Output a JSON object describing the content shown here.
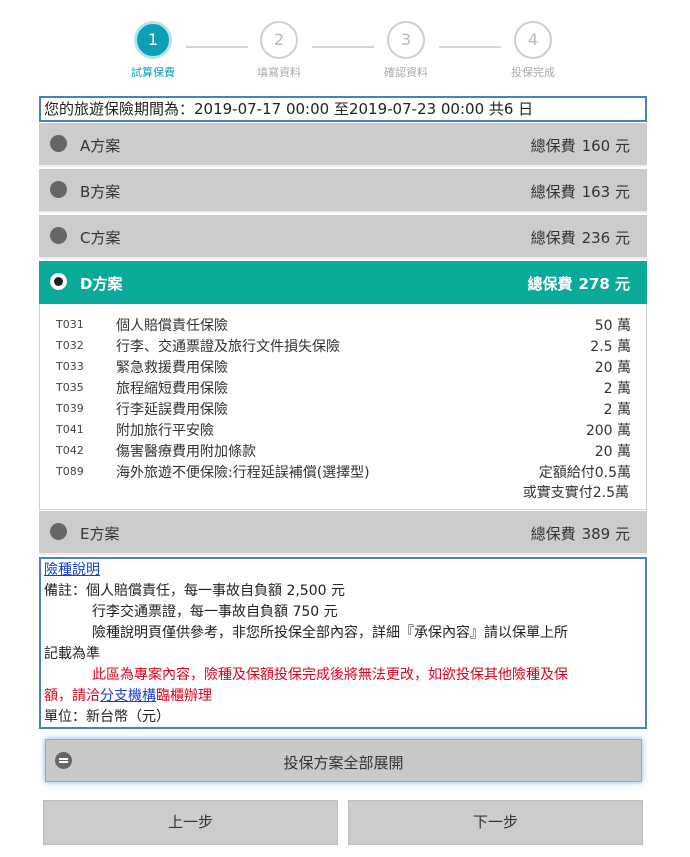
{
  "steps": [
    {
      "num": "1",
      "label": "試算保費",
      "active": true
    },
    {
      "num": "2",
      "label": "填寫資料",
      "active": false
    },
    {
      "num": "3",
      "label": "確認資料",
      "active": false
    },
    {
      "num": "4",
      "label": "投保完成",
      "active": false
    }
  ],
  "period_text": "您的旅遊保險期間為：2019-07-17 00:00 至2019-07-23 00:00 共6 日",
  "plans": [
    {
      "name": "A方案",
      "total_label": "總保費",
      "total_value": "160 元",
      "selected": false
    },
    {
      "name": "B方案",
      "total_label": "總保費",
      "total_value": "163 元",
      "selected": false
    },
    {
      "name": "C方案",
      "total_label": "總保費",
      "total_value": "236 元",
      "selected": false
    },
    {
      "name": "D方案",
      "total_label": "總保費",
      "total_value": "278 元",
      "selected": true
    },
    {
      "name": "E方案",
      "total_label": "總保費",
      "total_value": "389 元",
      "selected": false
    }
  ],
  "coverage": [
    {
      "code": "T031",
      "name": "個人賠償責任保險",
      "amount": "50 萬"
    },
    {
      "code": "T032",
      "name": "行李、交通票證及旅行文件損失保險",
      "amount": "2.5 萬"
    },
    {
      "code": "T033",
      "name": "緊急救援費用保險",
      "amount": "20 萬"
    },
    {
      "code": "T035",
      "name": "旅程縮短費用保險",
      "amount": "2 萬"
    },
    {
      "code": "T039",
      "name": "行李延誤費用保險",
      "amount": "2 萬"
    },
    {
      "code": "T041",
      "name": "附加旅行平安險",
      "amount": "200 萬"
    },
    {
      "code": "T042",
      "name": "傷害醫療費用附加條款",
      "amount": "20 萬"
    },
    {
      "code": "T089",
      "name": "海外旅遊不便保險:行程延誤補償(選擇型)",
      "amount": "定額給付0.5萬"
    }
  ],
  "coverage_extra": "或實支實付2.5萬",
  "notes": {
    "link": "險種說明",
    "line1": "備註：個人賠償責任，每一事故自負額 2,500 元",
    "line2": "行李交通票證，每一事故自負額 750 元",
    "line3a": "險種說明頁僅供參考，非您所投保全部內容，詳細『承保內容』請以保單上所",
    "line3b": "記載為準",
    "red_a": "此區為專案內容，險種及保額投保完成後將無法更改，如欲投保其他險種及保",
    "red_b1": "額，請洽",
    "red_link": "分支機構",
    "red_b2": "臨櫃辦理",
    "unit": "單位：新台幣（元）"
  },
  "expand_button": "投保方案全部展開",
  "prev_button": "上一步",
  "next_button": "下一步"
}
